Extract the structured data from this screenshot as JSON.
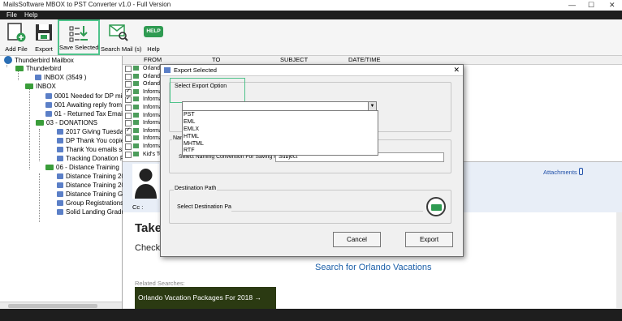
{
  "window": {
    "title": "MailsSoftware MBOX to PST Converter v1.0 - Full Version",
    "minimize": "—",
    "maximize": "☐",
    "close": "✕"
  },
  "menu": {
    "file": "File",
    "help": "Help"
  },
  "toolbar": {
    "add_file": "Add File",
    "export": "Export",
    "save_selected": "Save Selected",
    "search_mail": "Search Mail (s)",
    "help": "Help",
    "help_badge": "HELP"
  },
  "tree": {
    "root": "Thunderbird Mailbox",
    "thunderbird": "Thunderbird",
    "inbox_count": "INBOX (3549 )",
    "inbox": "INBOX",
    "items": [
      "0001 Needed for DP mig",
      "001 Awaiting reply from S",
      "01 - Returned Tax Email",
      "03 - DONATIONS",
      "2017 Giving Tuesday",
      "DP Thank You copie",
      "Thank You emails s",
      "Tracking Donation F",
      "06 - Distance Training",
      "Distance Training 20",
      "Distance Training 20",
      "Distance Training G",
      "Group Registrations",
      "Solid Landing Gradu"
    ]
  },
  "grid": {
    "headers": {
      "from": "FROM",
      "to": "TO",
      "subject": "SUBJECT",
      "date": "DATE/TIME"
    },
    "rows": [
      {
        "from": "Orlando",
        "checked": false
      },
      {
        "from": "Orlando",
        "checked": false
      },
      {
        "from": "Orlando",
        "checked": false
      },
      {
        "from": "Informat",
        "checked": true
      },
      {
        "from": "Informat",
        "checked": true
      },
      {
        "from": "Informat",
        "checked": false
      },
      {
        "from": "Informat",
        "checked": false
      },
      {
        "from": "Informat",
        "checked": false
      },
      {
        "from": "Informat",
        "checked": true
      },
      {
        "from": "Informat",
        "checked": false
      },
      {
        "from": "Informat",
        "checked": false
      },
      {
        "from": "Kid's To",
        "checked": false
      }
    ]
  },
  "preview": {
    "attachments": "Attachments",
    "cc": "Cc :"
  },
  "body": {
    "headline": "Take",
    "subline": "Check",
    "search_link": "Search for Orlando Vacations",
    "related": "Related Searches:",
    "package": "Orlando Vacation Packages For 2018 →"
  },
  "dialog": {
    "title": "Export Selected",
    "close": "✕",
    "export_option_label": "Select Export Option",
    "export_options": [
      "PST",
      "EML",
      "EMLX",
      "HTML",
      "MHTML",
      "RTF"
    ],
    "naming_group_label": "Nam",
    "naming_label": "Select Naming Convention For Saving Mails",
    "naming_value": "Subject",
    "dest_group_label": "Destination Path",
    "dest_label": "Select Destination Path",
    "cancel": "Cancel",
    "export": "Export"
  },
  "colors": {
    "accent_highlight": "#4fc38b",
    "menubar": "#1e1e1e",
    "link": "#1a5ea8"
  }
}
